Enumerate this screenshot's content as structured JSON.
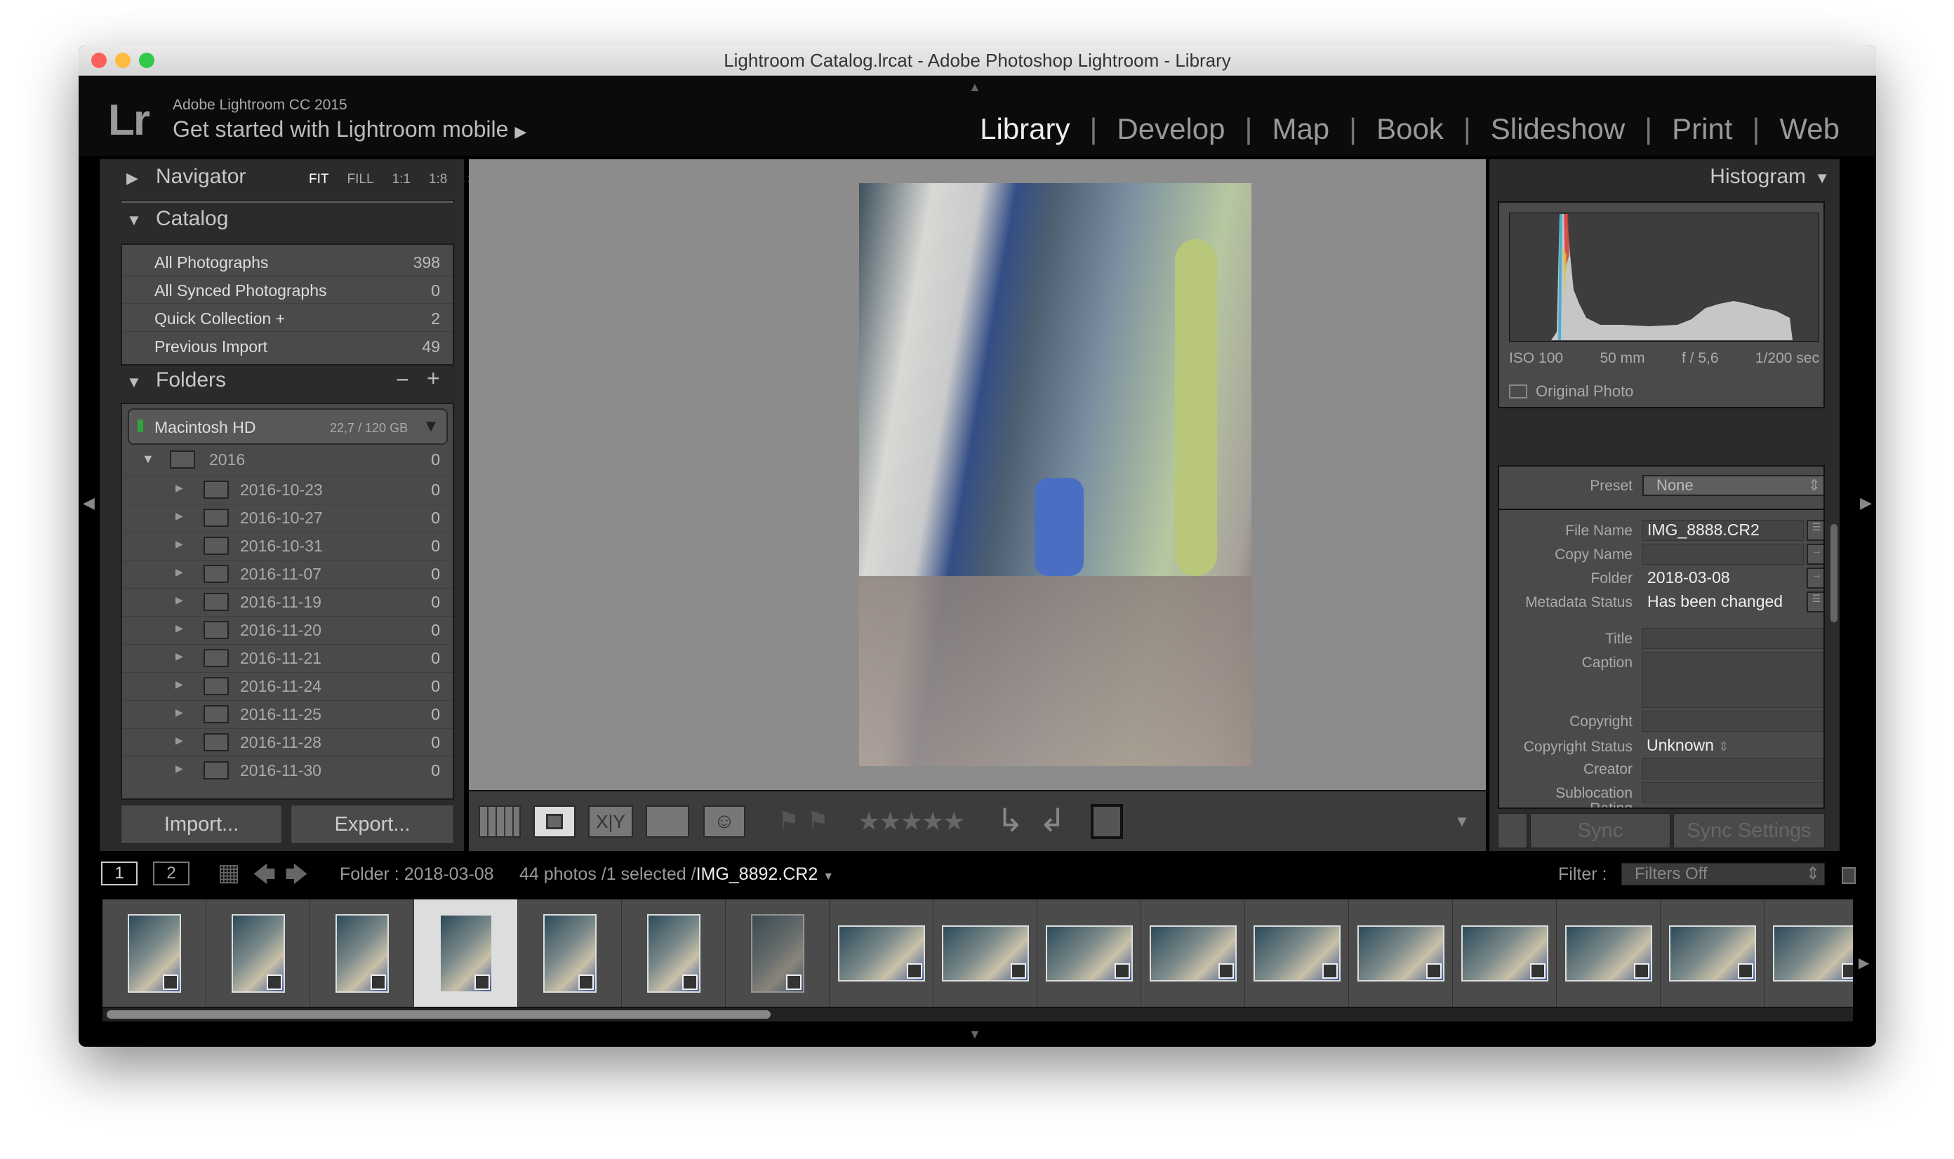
{
  "window": {
    "title": "Lightroom Catalog.lrcat - Adobe Photoshop Lightroom - Library"
  },
  "header": {
    "logo": "Lr",
    "product": "Adobe Lightroom CC 2015",
    "mobile": "Get started with Lightroom mobile"
  },
  "modules": [
    {
      "label": "Library",
      "active": true
    },
    {
      "label": "Develop"
    },
    {
      "label": "Map"
    },
    {
      "label": "Book"
    },
    {
      "label": "Slideshow"
    },
    {
      "label": "Print"
    },
    {
      "label": "Web"
    }
  ],
  "navigator": {
    "title": "Navigator",
    "zoom": [
      "FIT",
      "FILL",
      "1:1",
      "1:8"
    ]
  },
  "catalog": {
    "title": "Catalog",
    "items": [
      {
        "label": "All Photographs",
        "count": "398"
      },
      {
        "label": "All Synced Photographs",
        "count": "0"
      },
      {
        "label": "Quick Collection  +",
        "count": "2"
      },
      {
        "label": "Previous Import",
        "count": "49"
      }
    ]
  },
  "folders": {
    "title": "Folders",
    "drive": {
      "name": "Macintosh HD",
      "space": "22,7 / 120 GB"
    },
    "year": {
      "name": "2016",
      "count": "0"
    },
    "items": [
      {
        "name": "2016-10-23",
        "count": "0"
      },
      {
        "name": "2016-10-27",
        "count": "0"
      },
      {
        "name": "2016-10-31",
        "count": "0"
      },
      {
        "name": "2016-11-07",
        "count": "0"
      },
      {
        "name": "2016-11-19",
        "count": "0"
      },
      {
        "name": "2016-11-20",
        "count": "0"
      },
      {
        "name": "2016-11-21",
        "count": "0"
      },
      {
        "name": "2016-11-24",
        "count": "0"
      },
      {
        "name": "2016-11-25",
        "count": "0"
      },
      {
        "name": "2016-11-28",
        "count": "0"
      },
      {
        "name": "2016-11-30",
        "count": "0"
      }
    ]
  },
  "left_buttons": {
    "import": "Import...",
    "export": "Export..."
  },
  "histogram": {
    "title": "Histogram",
    "iso": "ISO 100",
    "focal": "50 mm",
    "aperture": "f / 5,6",
    "shutter": "1/200 sec",
    "original_photo": "Original Photo"
  },
  "metadata": {
    "preset_label": "Preset",
    "preset_value": "None",
    "fields": [
      {
        "label": "File Name",
        "value": "IMG_8888.CR2"
      },
      {
        "label": "Copy Name",
        "value": ""
      },
      {
        "label": "Folder",
        "value": "2018-03-08"
      },
      {
        "label": "Metadata Status",
        "value": "Has been changed"
      }
    ],
    "title_label": "Title",
    "caption_label": "Caption",
    "copyright_label": "Copyright",
    "copyright_status_label": "Copyright Status",
    "copyright_status_value": "Unknown",
    "creator_label": "Creator",
    "sublocation_label": "Sublocation",
    "rating_label": "Rating"
  },
  "right_buttons": {
    "sync": "Sync",
    "sync_settings": "Sync Settings"
  },
  "filmstrip": {
    "screen1": "1",
    "screen2": "2",
    "folder": "Folder : 2018-03-08",
    "count": "44 photos /1 selected /",
    "selected_file": "IMG_8892.CR2",
    "filter_label": "Filter :",
    "filter_value": "Filters Off",
    "thumb_count": 17,
    "selected_index": 3
  }
}
